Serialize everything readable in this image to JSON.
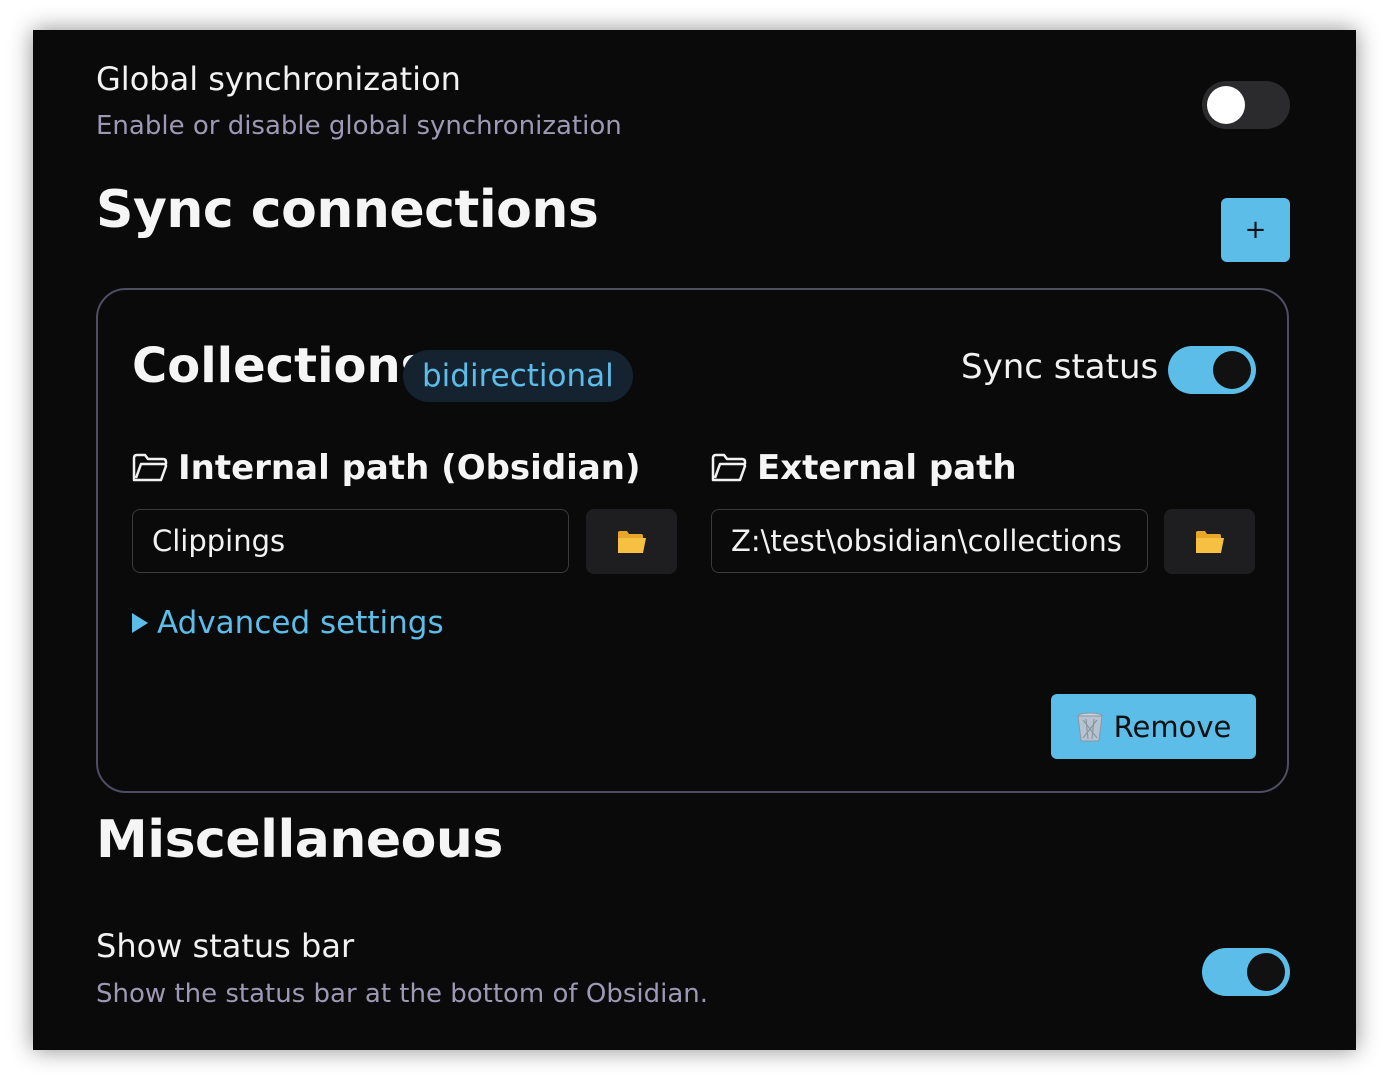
{
  "global_sync": {
    "name": "Global synchronization",
    "description": "Enable or disable global synchronization",
    "enabled": false
  },
  "sync_connections": {
    "heading": "Sync connections",
    "add_label": "+",
    "connections": [
      {
        "title": "Collections",
        "direction_badge": "bidirectional",
        "sync_status_label": "Sync status",
        "sync_status_enabled": true,
        "internal_path_label": "Internal path (Obsidian)",
        "internal_path_value": "Clippings",
        "external_path_label": "External path",
        "external_path_value": "Z:\\test\\obsidian\\collections",
        "advanced_label": "Advanced settings",
        "remove_label": "Remove"
      }
    ]
  },
  "misc": {
    "heading": "Miscellaneous",
    "status_bar": {
      "name": "Show status bar",
      "description": "Show the status bar at the bottom of Obsidian.",
      "enabled": true
    }
  },
  "colors": {
    "background": "#0a0a0b",
    "accent": "#5bbde8",
    "muted_text": "#9e98b4",
    "folder_icon": "#f5b935"
  },
  "icons": {
    "folder_outline": "folder-outline-icon",
    "folder_open": "folder-open-icon",
    "disclosure": "triangle-right-icon",
    "trash": "wastebasket-icon"
  }
}
